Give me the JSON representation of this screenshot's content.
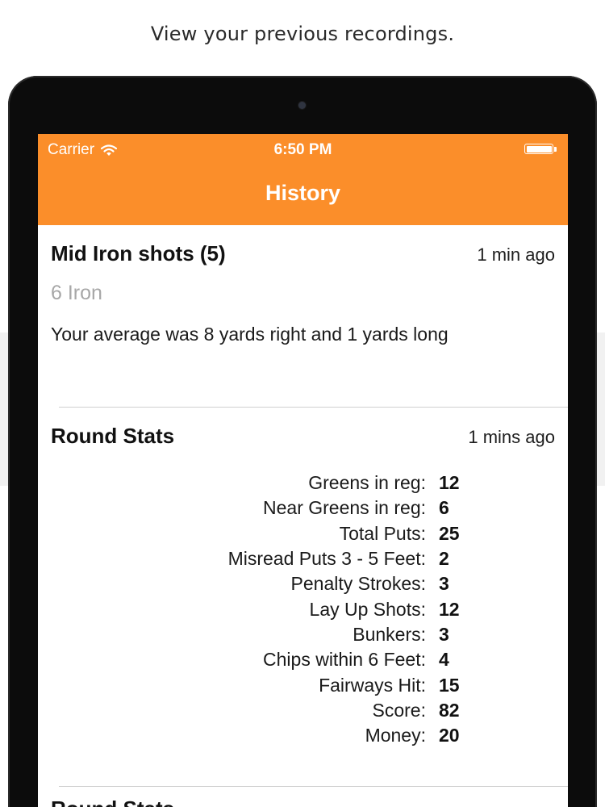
{
  "caption": "View your previous recordings.",
  "status_bar": {
    "carrier": "Carrier",
    "time": "6:50 PM"
  },
  "nav": {
    "title": "History"
  },
  "history": [
    {
      "title": "Mid Iron shots (5)",
      "time": "1 min ago",
      "subtitle": "6 Iron",
      "summary": "Your average was 8 yards right and 1 yards long"
    },
    {
      "title": "Round Stats",
      "time": "1 mins ago",
      "stats": [
        {
          "label": "Greens in reg:",
          "value": "12"
        },
        {
          "label": "Near Greens in reg:",
          "value": "6"
        },
        {
          "label": "Total Puts:",
          "value": "25"
        },
        {
          "label": "Misread Puts 3 - 5 Feet:",
          "value": "2"
        },
        {
          "label": "Penalty Strokes:",
          "value": "3"
        },
        {
          "label": "Lay Up Shots:",
          "value": "12"
        },
        {
          "label": "Bunkers:",
          "value": "3"
        },
        {
          "label": "Chips within 6 Feet:",
          "value": "4"
        },
        {
          "label": "Fairways Hit:",
          "value": "15"
        },
        {
          "label": "Score:",
          "value": "82"
        },
        {
          "label": "Money:",
          "value": "20"
        }
      ]
    },
    {
      "title": "Round Stats"
    }
  ]
}
